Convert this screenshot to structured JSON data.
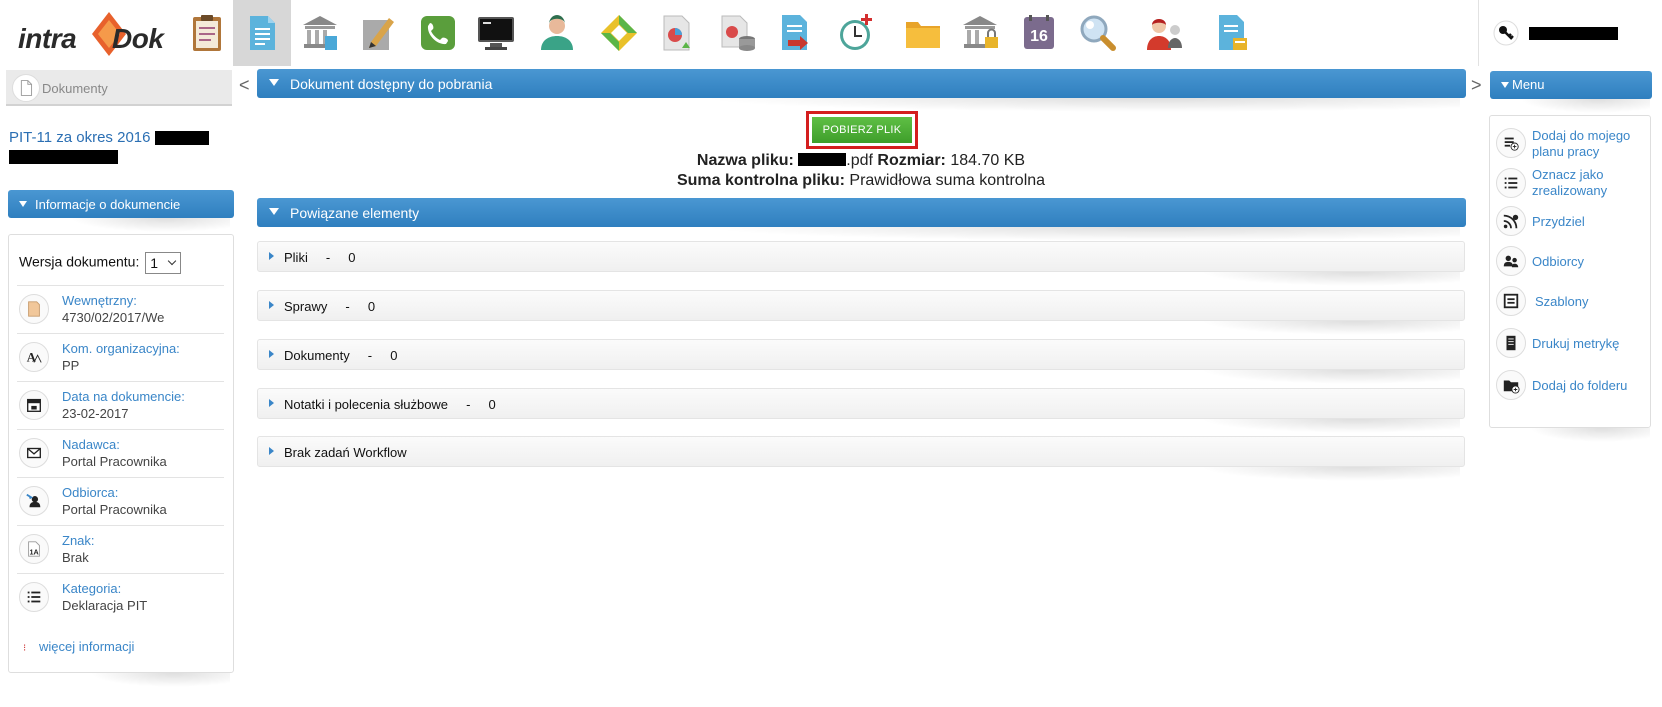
{
  "brand": {
    "logo_text_left": "intra",
    "logo_text_right": "Dok"
  },
  "toolbar": {
    "icons": [
      "clipboard-icon",
      "document-icon",
      "bank-icon",
      "pencil-icon",
      "phone-icon",
      "terminal-icon",
      "user-icon",
      "diamond-icon",
      "report-icon",
      "database-report-icon",
      "export-icon",
      "clock-add-icon",
      "folder-icon",
      "bank-lock-icon",
      "calendar-16-icon",
      "magnifier-icon",
      "users-icon",
      "notes-icon"
    ],
    "active_index": 1,
    "calendar_day": "16"
  },
  "left": {
    "tab_label": "Dokumenty",
    "doc_title": "PIT-11 za okres 2016",
    "info_header": "Informacje o dokumencie",
    "version_label": "Wersja dokumentu:",
    "version_value": "1",
    "items": [
      {
        "icon": "document-number-icon",
        "label": "Wewnętrzny:",
        "value": "4730/02/2017/We"
      },
      {
        "icon": "org-unit-icon",
        "label": "Kom. organizacyjna:",
        "value": "PP"
      },
      {
        "icon": "calendar-icon",
        "label": "Data na dokumencie:",
        "value": "23-02-2017"
      },
      {
        "icon": "envelope-icon",
        "label": "Nadawca:",
        "value": "Portal Pracownika"
      },
      {
        "icon": "recipient-icon",
        "label": "Odbiorca:",
        "value": "Portal Pracownika"
      },
      {
        "icon": "sign-icon",
        "label": "Znak:",
        "value": "Brak"
      },
      {
        "icon": "list-icon",
        "label": "Kategoria:",
        "value": "Deklaracja PIT"
      }
    ],
    "more_info": "więcej informacji"
  },
  "main": {
    "nav_prev": "<",
    "nav_next": ">",
    "download_header": "Dokument dostępny do pobrania",
    "download_button": "POBIERZ PLIK",
    "file_name_label": "Nazwa pliku:",
    "file_ext": ".pdf",
    "size_label": "Rozmiar:",
    "size_value": "184.70 KB",
    "checksum_label": "Suma kontrolna pliku:",
    "checksum_value": "Prawidłowa suma kontrolna",
    "related_header": "Powiązane elementy",
    "related": [
      {
        "label": "Pliki",
        "count": "0"
      },
      {
        "label": "Sprawy",
        "count": "0"
      },
      {
        "label": "Dokumenty",
        "count": "0"
      },
      {
        "label": "Notatki i polecenia służbowe",
        "count": "0"
      },
      {
        "label": "Brak zadań Workflow",
        "count": ""
      }
    ]
  },
  "right": {
    "menu_header": "Menu",
    "items": [
      {
        "icon": "add-to-plan-icon",
        "label": "Dodaj do mojego planu pracy"
      },
      {
        "icon": "mark-done-icon",
        "label": "Oznacz jako zrealizowany"
      },
      {
        "icon": "assign-icon",
        "label": "Przydziel"
      },
      {
        "icon": "recipients-icon",
        "label": "Odbiorcy"
      },
      {
        "icon": "templates-icon",
        "label": "Szablony"
      },
      {
        "icon": "print-icon",
        "label": "Drukuj metrykę"
      },
      {
        "icon": "add-folder-icon",
        "label": "Dodaj do folderu"
      }
    ]
  }
}
